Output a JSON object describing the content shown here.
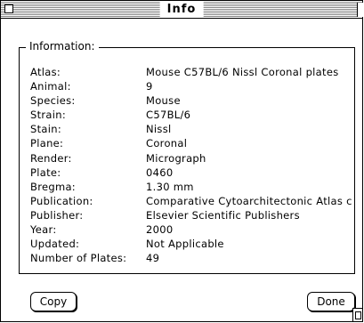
{
  "window": {
    "title": "Info"
  },
  "group": {
    "label": "Information:"
  },
  "fields": [
    {
      "label": "Atlas:",
      "value": "Mouse C57BL/6 Nissl Coronal plates"
    },
    {
      "label": "Animal:",
      "value": "9"
    },
    {
      "label": "Species:",
      "value": "Mouse"
    },
    {
      "label": "Strain:",
      "value": "C57BL/6"
    },
    {
      "label": "Stain:",
      "value": "Nissl"
    },
    {
      "label": "Plane:",
      "value": "Coronal"
    },
    {
      "label": "Render:",
      "value": "Micrograph"
    },
    {
      "label": "Plate:",
      "value": "0460"
    },
    {
      "label": "Bregma:",
      "value": "1.30 mm"
    },
    {
      "label": "Publication:",
      "value": "Comparative Cytoarchitectonic Atlas c"
    },
    {
      "label": "Publisher:",
      "value": "Elsevier Scientific Publishers"
    },
    {
      "label": "Year:",
      "value": "2000"
    },
    {
      "label": "Updated:",
      "value": "Not Applicable"
    },
    {
      "label": "Number of Plates:",
      "value": "49"
    }
  ],
  "buttons": {
    "copy": "Copy",
    "done": "Done"
  }
}
